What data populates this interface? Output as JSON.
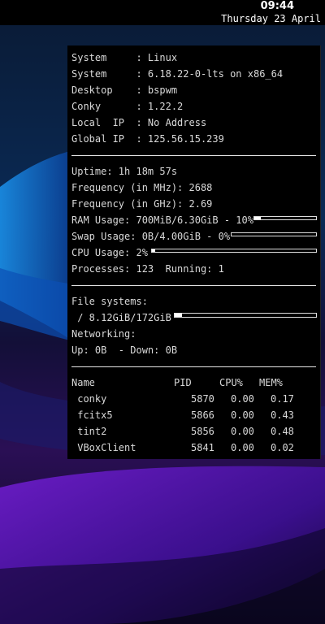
{
  "topbar": {
    "time": "09:44",
    "date": "Thursday 23 April"
  },
  "system_info": [
    {
      "label": "System     ",
      "value": ": Linux"
    },
    {
      "label": "System     ",
      "value": ": 6.18.22-0-lts on x86_64"
    },
    {
      "label": "Desktop    ",
      "value": ": bspwm"
    },
    {
      "label": "Conky      ",
      "value": ": 1.22.2"
    },
    {
      "label": "Local  IP  ",
      "value": ": No Address"
    },
    {
      "label": "Global IP  ",
      "value": ": 125.56.15.239"
    }
  ],
  "stats": {
    "uptime": "Uptime: 1h 18m 57s",
    "freq_mhz": "Frequency (in MHz): 2688",
    "freq_ghz": "Frequency (in GHz): 2.69",
    "ram": "RAM Usage: 700MiB/6.30GiB - 10%",
    "ram_percent": 10,
    "swap": "Swap Usage: 0B/4.00GiB - 0%",
    "swap_percent": 0,
    "cpu": "CPU Usage: 2%",
    "cpu_percent": 2,
    "processes": "Processes: 123  Running: 1"
  },
  "filesystems": {
    "heading": "File systems:",
    "root": " / 8.12GiB/172GiB",
    "root_percent": 5,
    "net_heading": "Networking:",
    "net": "Up: 0B  - Down: 0B"
  },
  "processes": {
    "headers": {
      "name": "Name",
      "pid": "PID",
      "cpu": "CPU%",
      "mem": "MEM%"
    },
    "rows": [
      {
        "name": " conky",
        "pid": "5870",
        "cpu": "0.00",
        "mem": "0.17"
      },
      {
        "name": " fcitx5",
        "pid": "5866",
        "cpu": "0.00",
        "mem": "0.43"
      },
      {
        "name": " tint2",
        "pid": "5856",
        "cpu": "0.00",
        "mem": "0.48"
      },
      {
        "name": " VBoxClient",
        "pid": "5841",
        "cpu": "0.00",
        "mem": "0.02"
      }
    ]
  }
}
